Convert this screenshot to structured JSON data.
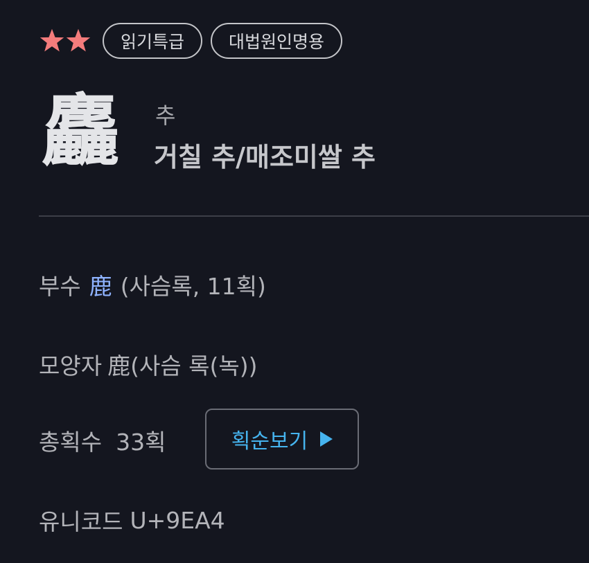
{
  "rating": {
    "stars_filled": 2,
    "star_color": "#f47c7c"
  },
  "tags": [
    {
      "label": "읽기특급"
    },
    {
      "label": "대법원인명용"
    }
  ],
  "character": {
    "hanja": "麤",
    "reading": "추",
    "meaning": "거칠 추/매조미쌀 추"
  },
  "info": {
    "radical_label": "부수",
    "radical_char": "鹿",
    "radical_detail": "(사슴록, 11획)",
    "shape_label": "모양자",
    "shape_char": "鹿",
    "shape_detail": "(사슴 록(녹))",
    "strokes_label": "총획수",
    "strokes_value": "33획",
    "stroke_order_button": "획순보기",
    "unicode_label": "유니코드",
    "unicode_value": "U+9EA4"
  },
  "colors": {
    "background": "#14161f",
    "link": "#8fb3ff",
    "accent": "#46b4ef"
  },
  "icons": {
    "star": "star-icon",
    "play": "play-icon"
  }
}
